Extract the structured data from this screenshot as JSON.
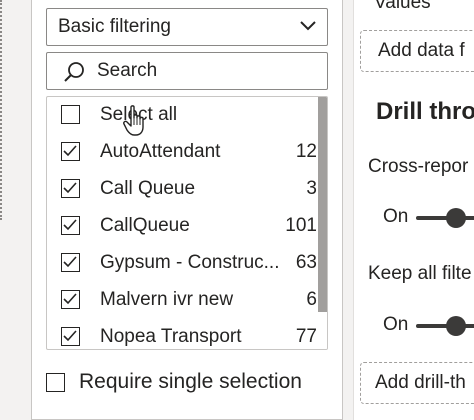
{
  "filter": {
    "type_label": "Basic filtering",
    "search_placeholder": "Search",
    "select_all_label": "Select all",
    "items": [
      {
        "label": "AutoAttendant",
        "count": "12"
      },
      {
        "label": "Call Queue",
        "count": "3"
      },
      {
        "label": "CallQueue",
        "count": "101"
      },
      {
        "label": "Gypsum - Construc...",
        "count": "63"
      },
      {
        "label": "Malvern ivr new",
        "count": "6"
      },
      {
        "label": "Nopea Transport",
        "count": "77"
      }
    ],
    "single_selection_label": "Require single selection"
  },
  "right_panel": {
    "values_label": "Values",
    "add_data_label": "Add data f",
    "drill_title": "Drill thro",
    "cross_report_label": "Cross-repor",
    "cross_report_state": "On",
    "keep_filters_label": "Keep all filte",
    "keep_filters_state": "On",
    "add_drill_label": "Add drill-th"
  },
  "colors": {
    "panel_bg": "#f3f2f1",
    "card_bg": "#ffffff",
    "toggle": "#3b3a39",
    "scroll_thumb": "#a19f9d"
  }
}
